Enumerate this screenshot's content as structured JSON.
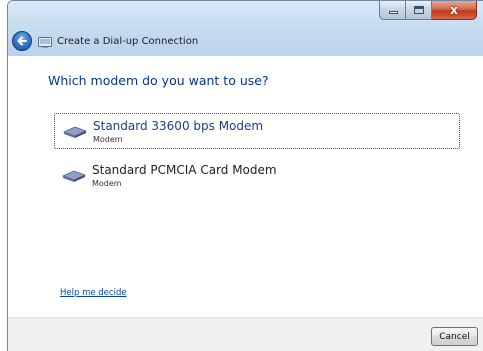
{
  "window": {
    "title": "Create a Dial-up Connection",
    "close_glyph": "x"
  },
  "content": {
    "heading": "Which modem do you want to use?",
    "options": [
      {
        "title": "Standard 33600 bps Modem",
        "subtitle": "Modem",
        "selected": true
      },
      {
        "title": "Standard PCMCIA Card Modem",
        "subtitle": "Modem",
        "selected": false
      }
    ],
    "help_link": "Help me decide"
  },
  "footer": {
    "cancel_label": "Cancel"
  },
  "icons": {
    "back": "back-arrow-icon",
    "wizard": "dialup-connection-icon",
    "modem": "modem-icon"
  },
  "colors": {
    "heading": "#003399",
    "link": "#0645ad",
    "selected_title": "#1e3c8c",
    "close_button": "#c3391c"
  }
}
